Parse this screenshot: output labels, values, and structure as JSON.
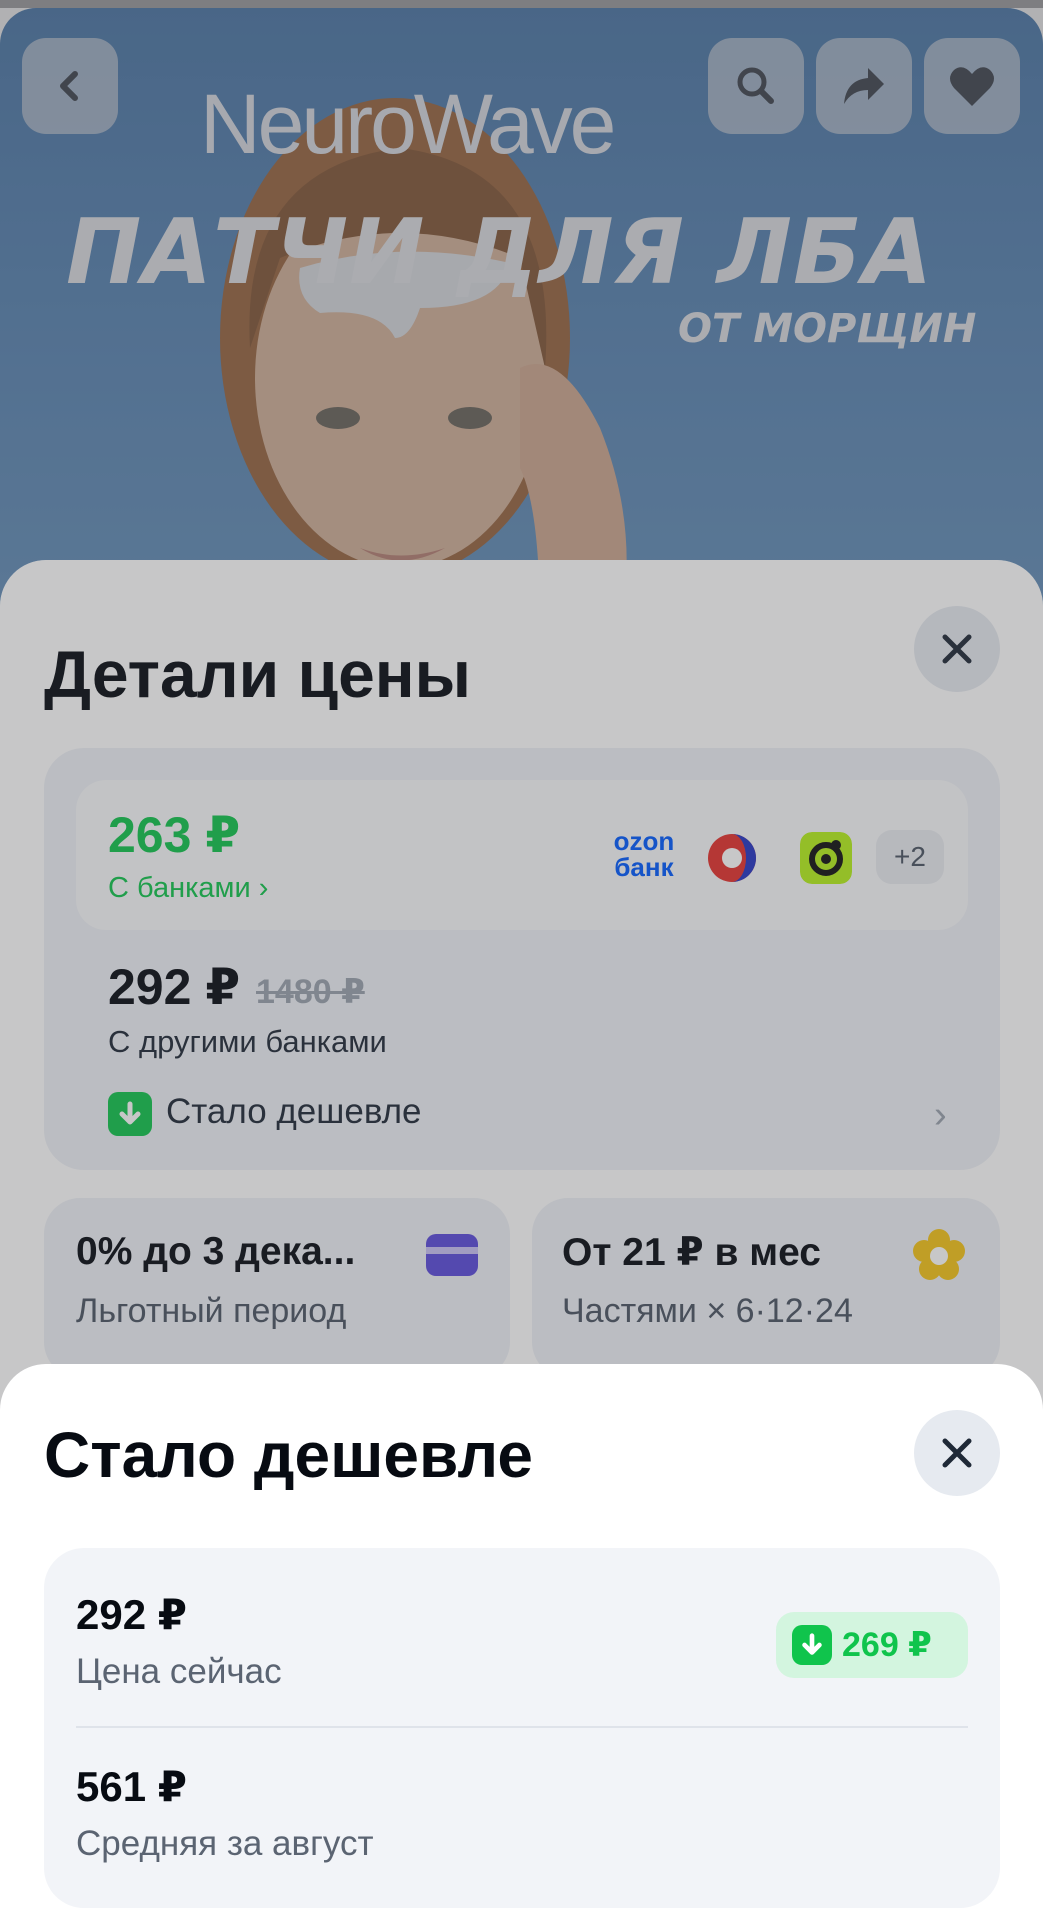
{
  "hero": {
    "brand_part1": "Neuro",
    "brand_part2": "Wave",
    "headline": "ПАТЧИ ДЛЯ ЛБА",
    "subline": "ОТ МОРЩИН",
    "icons": [
      "back-icon",
      "search-icon",
      "share-icon",
      "heart-icon"
    ]
  },
  "price_details": {
    "title": "Детали цены",
    "bank_price": "263 ₽",
    "bank_link": "С банками ›",
    "ozon_logo_line1": "ozon",
    "ozon_logo_line2": "банк",
    "more_banks": "+2",
    "other_price": "292 ₽",
    "old_price": "1480 ₽",
    "other_label": "С другими банками",
    "cheaper_link": "Стало дешевле",
    "installment_card": {
      "title": "0% до 3 дека...",
      "subtitle": "Льготный период"
    },
    "parts_card": {
      "title": "От 21 ₽ в мес",
      "subtitle": "Частями × 6·12·24"
    }
  },
  "cheaper_sheet": {
    "title": "Стало дешевле",
    "current_price": "292 ₽",
    "current_label": "Цена сейчас",
    "drop_badge": "269 ₽",
    "average_price": "561 ₽",
    "average_label": "Средняя за август"
  },
  "colors": {
    "accent_green": "#10c44c",
    "ozon_blue": "#005bff",
    "card_purple": "#5b4bdb",
    "parts_yellow": "#f5c518"
  }
}
